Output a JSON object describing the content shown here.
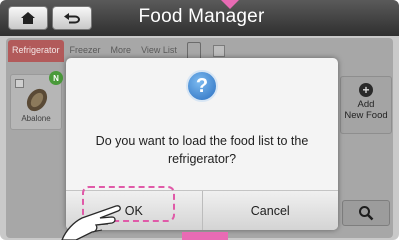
{
  "app": {
    "title": "Food Manager"
  },
  "topbar": {
    "home_icon": "home-icon",
    "back_icon": "back-arrow-icon"
  },
  "tabs": [
    {
      "label": "Refrigerator",
      "active": true
    },
    {
      "label": "Freezer",
      "active": false
    },
    {
      "label": "More",
      "active": false
    },
    {
      "label": "View List",
      "active": false
    }
  ],
  "food_items": [
    {
      "label": "Abalone",
      "badge": "N"
    }
  ],
  "side": {
    "add_label_line1": "Add",
    "add_label_line2": "New Food",
    "search_icon": "search-icon"
  },
  "dialog": {
    "icon": "question-icon",
    "icon_glyph": "?",
    "message": "Do you want to load the food list to the refrigerator?",
    "ok_label": "OK",
    "cancel_label": "Cancel"
  },
  "colors": {
    "highlight": "#e05aa8",
    "active_tab": "#b25a5a",
    "question_icon": "#2a6fc0"
  }
}
